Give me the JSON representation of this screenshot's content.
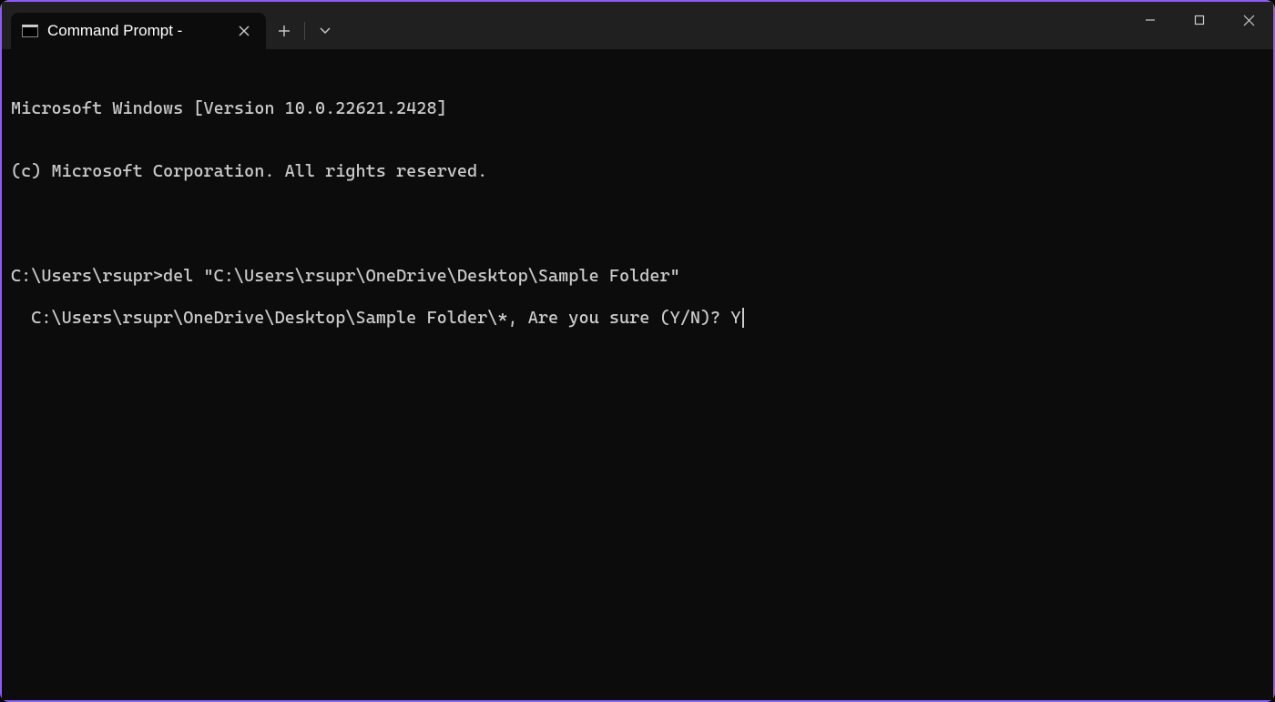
{
  "titlebar": {
    "tab_title": "Command Prompt - "
  },
  "terminal": {
    "lines": [
      "Microsoft Windows [Version 10.0.22621.2428]",
      "(c) Microsoft Corporation. All rights reserved.",
      "",
      "C:\\Users\\rsupr>del \"C:\\Users\\rsupr\\OneDrive\\Desktop\\Sample Folder\"",
      "C:\\Users\\rsupr\\OneDrive\\Desktop\\Sample Folder\\*, Are you sure (Y/N)? Y"
    ]
  }
}
